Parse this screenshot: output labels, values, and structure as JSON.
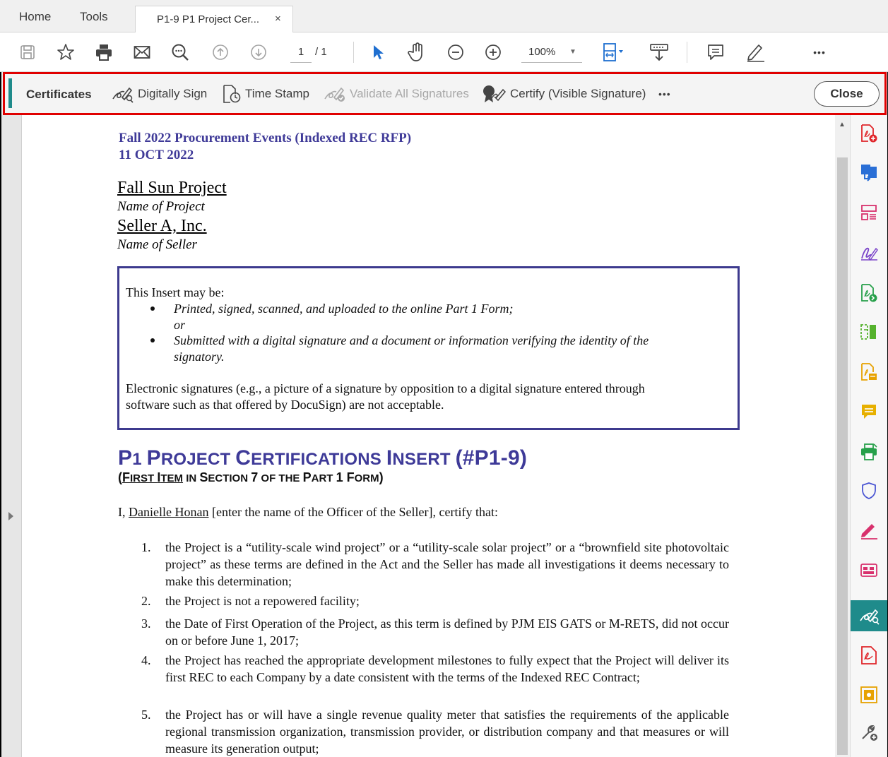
{
  "tabs": {
    "home": "Home",
    "tools": "Tools",
    "document": "P1-9 P1 Project Cer...",
    "close_symbol": "×"
  },
  "toolbar": {
    "icons": [
      "save-icon",
      "star-icon",
      "print-icon",
      "email-icon",
      "find-icon",
      "page-up-icon",
      "page-down-icon",
      "select-arrow-icon",
      "hand-icon",
      "zoom-out-icon",
      "zoom-in-icon",
      "fit-page-icon",
      "read-mode-icon",
      "comment-icon",
      "pen-icon",
      "more-icon"
    ],
    "page_current": "1",
    "page_total": "/ 1",
    "zoom": "100%",
    "more": "•••"
  },
  "certbar": {
    "label": "Certificates",
    "digitally_sign": "Digitally Sign",
    "time_stamp": "Time Stamp",
    "validate_all": "Validate All Signatures",
    "certify": "Certify (Visible Signature)",
    "more": "•••",
    "close": "Close",
    "accent_color": "#1f8b8b",
    "highlight_color": "#e00000"
  },
  "doc": {
    "header_line1": "Fall 2022 Procurement Events (Indexed REC RFP)",
    "header_line2": "11 OCT 2022",
    "project_name": "Fall Sun Project",
    "project_caption": "Name of Project",
    "seller_name": "Seller A, Inc.",
    "seller_caption": "Name of Seller",
    "insert_intro": "This Insert may be:",
    "bullet1": "Printed, signed, scanned, and uploaded to the online Part 1 Form;",
    "or": "or",
    "bullet2_line1": "Submitted with a digital signature and a document or information verifying the identity of the",
    "bullet2_line2": "signatory.",
    "electronic_line1": "Electronic signatures (e.g., a picture of a signature by opposition to a digital signature entered through",
    "electronic_line2": "software such as that offered by DocuSign) are not acceptable.",
    "section_title_parts": [
      "P",
      "1 ",
      "P",
      "ROJECT ",
      "C",
      "ERTIFICATIONS ",
      "I",
      "NSERT ",
      "(#P1-9)"
    ],
    "section_sub_parts": [
      "(",
      "F",
      "IRST ",
      "I",
      "TEM",
      " IN ",
      "S",
      "ECTION ",
      "7",
      " OF THE ",
      "P",
      "ART ",
      "1",
      " F",
      "ORM",
      ")"
    ],
    "certify_prefix": "I, ",
    "officer_name": "Danielle Honan",
    "certify_suffix": " [enter the name of the Officer of the Seller], certify that:",
    "items": [
      {
        "num": "1.",
        "text": "the Project is a “utility-scale wind project” or a “utility-scale solar project” or a “brownfield site photovoltaic project” as these terms are defined in the Act and the Seller has made all investigations it deems necessary to make this determination;"
      },
      {
        "num": "2.",
        "text": "the Project is not a repowered facility;"
      },
      {
        "num": "3.",
        "text": "the Date of First Operation of the Project, as this term is defined by PJM EIS GATS or M-RETS, did not occur on or before June 1, 2017;"
      },
      {
        "num": "4.",
        "text": "the Project has reached the appropriate development milestones to fully expect that the Project will deliver its first REC to each Company by a date consistent with the terms of the Indexed REC Contract;"
      },
      {
        "num": "5.",
        "text": "the Project has or will have a single revenue quality meter that satisfies the requirements of the applicable regional transmission organization, transmission provider, or distribution company and that measures or will measure its generation output;"
      }
    ]
  },
  "right_panel": {
    "icons": [
      "create-pdf-icon",
      "export-pdf-icon",
      "organize-pages-icon",
      "fill-sign-icon",
      "send-for-review-icon",
      "compare-icon",
      "edit-pdf-icon",
      "comment-icon",
      "print-production-icon",
      "protect-icon",
      "request-signatures-icon",
      "redact-icon",
      "certificates-icon",
      "acrobat-pdf-icon",
      "action-wizard-icon",
      "more-tools-icon"
    ],
    "active_icon": "certificates-icon"
  }
}
